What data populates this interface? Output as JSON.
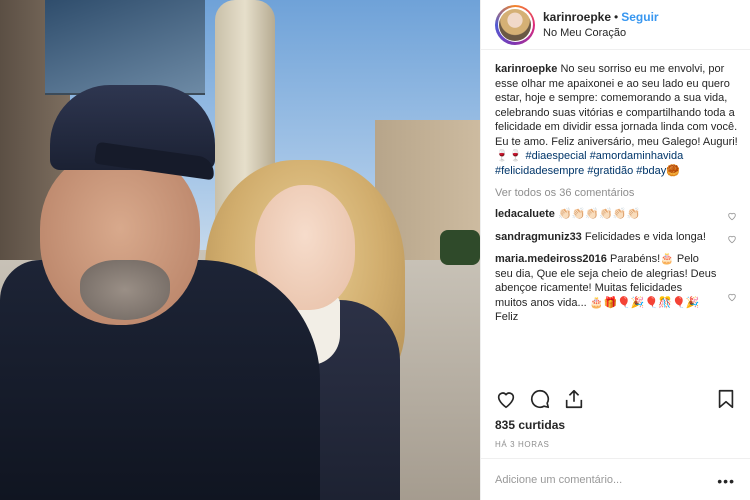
{
  "post": {
    "username": "karinroepke",
    "separator": "•",
    "follow_label": "Seguir",
    "location": "No Meu Coração",
    "caption_user": "karinroepke",
    "caption_text": "No seu sorriso eu me envolvi, por esse olhar me apaixonei e ao seu lado eu quero estar, hoje e sempre: comemorando a sua vida, celebrando suas vitórias e compartilhando toda a felicidade em dividir essa jornada linda com você. Eu te amo. Feliz aniversário, meu Galego! Auguri! 🍷🍷",
    "hashtags": [
      "#diaespecial",
      "#amordaminhavida",
      "#felicidadesempre",
      "#gratidão",
      "#bday"
    ],
    "tail_emoji": "🥮",
    "view_all": "Ver todos os 36 comentários"
  },
  "comments": [
    {
      "user": "ledacaluete",
      "text": "👏🏻👏🏻👏🏻👏🏻👏🏻👏🏻"
    },
    {
      "user": "sandragmuniz33",
      "text": "Felicidades e vida longa!"
    },
    {
      "user": "maria.medeiross2016",
      "text": "Parabéns!🎂 Pelo seu dia, Que ele seja cheio de alegrias! Deus abençoe ricamente! Muitas felicidades muitos anos vida... 🎂🎁🎈🎉🎈🎊🎈🎉Feliz"
    }
  ],
  "likes": "835 curtidas",
  "time": "HÁ 3 HORAS",
  "add_comment_placeholder": "Adicione um comentário...",
  "more_dots": "•••",
  "colors": {
    "accent": "#3897f0",
    "border": "#efefef",
    "muted": "#8e8e8e",
    "hashtag": "#003569"
  },
  "icons": [
    "heart-icon",
    "comment-icon",
    "share-icon",
    "bookmark-icon"
  ]
}
